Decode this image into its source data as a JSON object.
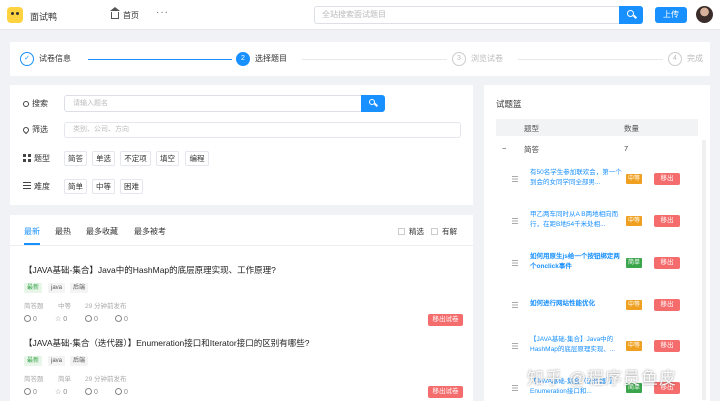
{
  "header": {
    "brand": "面试鸭",
    "home_label": "首页",
    "more_label": "···",
    "search_placeholder": "全站搜索面试题目",
    "upload_label": "上传"
  },
  "steps": [
    {
      "num": "✓",
      "label": "试卷信息"
    },
    {
      "num": "2",
      "label": "选择题目"
    },
    {
      "num": "3",
      "label": "浏览试卷"
    },
    {
      "num": "4",
      "label": "完成"
    }
  ],
  "filters": {
    "search_label": "搜索",
    "search_placeholder": "请输入题名",
    "filter_label": "筛选",
    "filter_placeholder": "类别、公司、方向",
    "type_label": "题型",
    "type_options": [
      "简答",
      "单选",
      "不定项",
      "填空",
      "编程"
    ],
    "difficulty_label": "难度",
    "difficulty_options": [
      "简单",
      "中等",
      "困难"
    ]
  },
  "list": {
    "tabs": [
      "最新",
      "最热",
      "最多收藏",
      "最多被考"
    ],
    "checks": [
      "精选",
      "有解"
    ],
    "questions": [
      {
        "title": "【JAVA基础-集合】Java中的HashMap的底层原理实现、工作原理?",
        "tags": [
          "最新",
          "java",
          "后端"
        ],
        "type": "简答题",
        "difficulty": "中等",
        "time": "29 分钟前发布",
        "views": "0",
        "stars": "0",
        "comments": "0",
        "tests": "0",
        "action": "移出试卷"
      },
      {
        "title": "【JAVA基础-集合（迭代器）】Enumeration接口和Iterator接口的区别有哪些?",
        "tags": [
          "最新",
          "java",
          "后端"
        ],
        "type": "简答题",
        "difficulty": "简单",
        "time": "29 分钟前发布",
        "views": "0",
        "stars": "0",
        "comments": "0",
        "tests": "0",
        "action": "移出试卷"
      }
    ]
  },
  "basket": {
    "title": "试题篮",
    "col_type": "题型",
    "col_count": "数量",
    "group_toggle": "−",
    "group_name": "简答",
    "group_count": "7",
    "items": [
      {
        "text": "有50名学生参加联欢会，第一个到会的女同学同全部男...",
        "level": "中等",
        "action": "移出"
      },
      {
        "text": "甲乙两车同时从A B两地相向而行，在距B地54千米处相...",
        "level": "中等",
        "action": "移出"
      },
      {
        "text": "如何用原生js给一个按钮绑定两个onclick事件",
        "level": "简单",
        "action": "移出"
      },
      {
        "text": "如何进行网站性能优化",
        "level": "中等",
        "action": "移出"
      },
      {
        "text": "【JAVA基础-集合】Java中的HashMap的底层原理实现、...",
        "level": "中等",
        "action": "移出"
      },
      {
        "text": "【JAVA基础-集合（迭代器）】Enumeration接口和...",
        "level": "简单",
        "action": "移出"
      }
    ]
  },
  "watermark": "知乎 @程序员鱼皮",
  "colors": {
    "accent": "#1890ff",
    "danger": "#f56c6c",
    "green": "#3aa54a",
    "orange": "#f0a020"
  }
}
